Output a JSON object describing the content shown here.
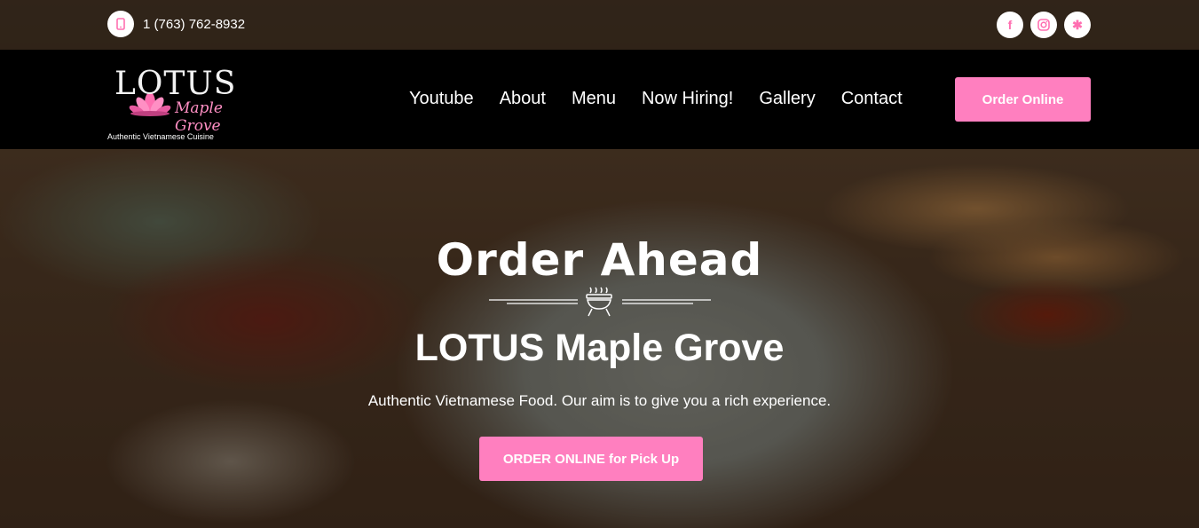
{
  "topbar": {
    "phone": "1 (763) 762-8932",
    "socials": [
      {
        "icon": "facebook-icon",
        "glyph": "f"
      },
      {
        "icon": "instagram-icon",
        "glyph": "◎"
      },
      {
        "icon": "yelp-icon",
        "glyph": "✱"
      }
    ]
  },
  "navbar": {
    "logo": {
      "line1": "LOTUS",
      "line2": "Maple Grove"
    },
    "tagline": "Authentic Vietnamese Cuisine",
    "items": [
      "Youtube",
      "About",
      "Menu",
      "Now Hiring!",
      "Gallery",
      "Contact"
    ],
    "order_button": "Order Online"
  },
  "hero": {
    "script_title": "Order Ahead",
    "title": "LOTUS Maple Grove",
    "subtitle": "Authentic Vietnamese Food. Our aim is to give you a rich experience.",
    "cta": "ORDER ONLINE for Pick Up"
  },
  "colors": {
    "accent": "#ff7fbf",
    "navbar_bg": "#000000",
    "social_icon": "#ff6fb1"
  }
}
